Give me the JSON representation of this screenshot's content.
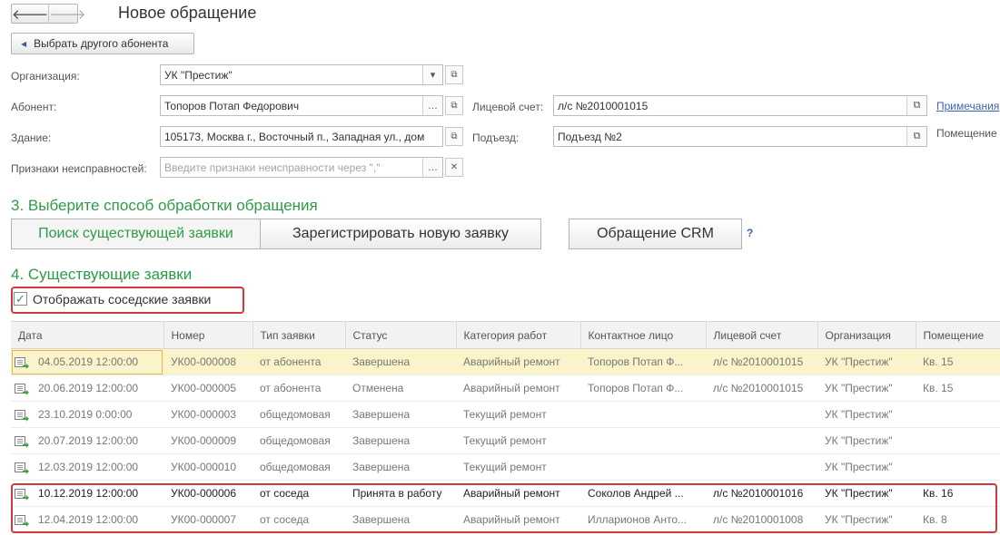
{
  "header": {
    "back": "🡐",
    "forward": "🡒",
    "title": "Новое обращение"
  },
  "choose_button": "Выбрать другого абонента",
  "form": {
    "org_label": "Организация:",
    "org_value": "УК \"Престиж\"",
    "abonent_label": "Абонент:",
    "abonent_value": "Топоров Потап Федорович",
    "account_label": "Лицевой счет:",
    "account_value": "л/с №2010001015",
    "notes_link": "Примечания",
    "building_label": "Здание:",
    "building_value": "105173, Москва г., Восточный п., Западная ул., дом",
    "entrance_label": "Подъезд:",
    "entrance_value": "Подъезд №2",
    "room_label": "Помещение",
    "defects_label": "Признаки неисправностей:",
    "defects_placeholder": "Введите признаки неисправности через \",\""
  },
  "section3": {
    "title": "3. Выберите способ обработки обращения",
    "btn_search": "Поиск существующей заявки",
    "btn_register": "Зарегистрировать новую заявку",
    "btn_crm": "Обращение CRM",
    "help": "?"
  },
  "section4": {
    "title": "4. Существующие заявки",
    "checkbox_label": "Отображать соседские заявки",
    "checkbox_checked": true
  },
  "table": {
    "columns": [
      "Дата",
      "Номер",
      "Тип заявки",
      "Статус",
      "Категория работ",
      "Контактное лицо",
      "Лицевой счет",
      "Организация",
      "Помещение"
    ],
    "rows": [
      [
        "04.05.2019 12:00:00",
        "УК00-000008",
        "от абонента",
        "Завершена",
        "Аварийный ремонт",
        "Топоров Потап Ф...",
        "л/с №2010001015",
        "УК \"Престиж\"",
        "Кв. 15"
      ],
      [
        "20.06.2019 12:00:00",
        "УК00-000005",
        "от абонента",
        "Отменена",
        "Аварийный ремонт",
        "Топоров Потап Ф...",
        "л/с №2010001015",
        "УК \"Престиж\"",
        "Кв. 15"
      ],
      [
        "23.10.2019 0:00:00",
        "УК00-000003",
        "общедомовая",
        "Завершена",
        "Текущий ремонт",
        "",
        "",
        "УК \"Престиж\"",
        ""
      ],
      [
        "20.07.2019 12:00:00",
        "УК00-000009",
        "общедомовая",
        "Завершена",
        "Текущий ремонт",
        "",
        "",
        "УК \"Престиж\"",
        ""
      ],
      [
        "12.03.2019 12:00:00",
        "УК00-000010",
        "общедомовая",
        "Завершена",
        "Текущий ремонт",
        "",
        "",
        "УК \"Престиж\"",
        ""
      ],
      [
        "10.12.2019 12:00:00",
        "УК00-000006",
        "от соседа",
        "Принята в работу",
        "Аварийный ремонт",
        "Соколов Андрей ...",
        "л/с №2010001016",
        "УК \"Престиж\"",
        "Кв. 16"
      ],
      [
        "12.04.2019 12:00:00",
        "УК00-000007",
        "от соседа",
        "Завершена",
        "Аварийный ремонт",
        "Илларионов Анто...",
        "л/с №2010001008",
        "УК \"Престиж\"",
        "Кв. 8"
      ]
    ]
  }
}
